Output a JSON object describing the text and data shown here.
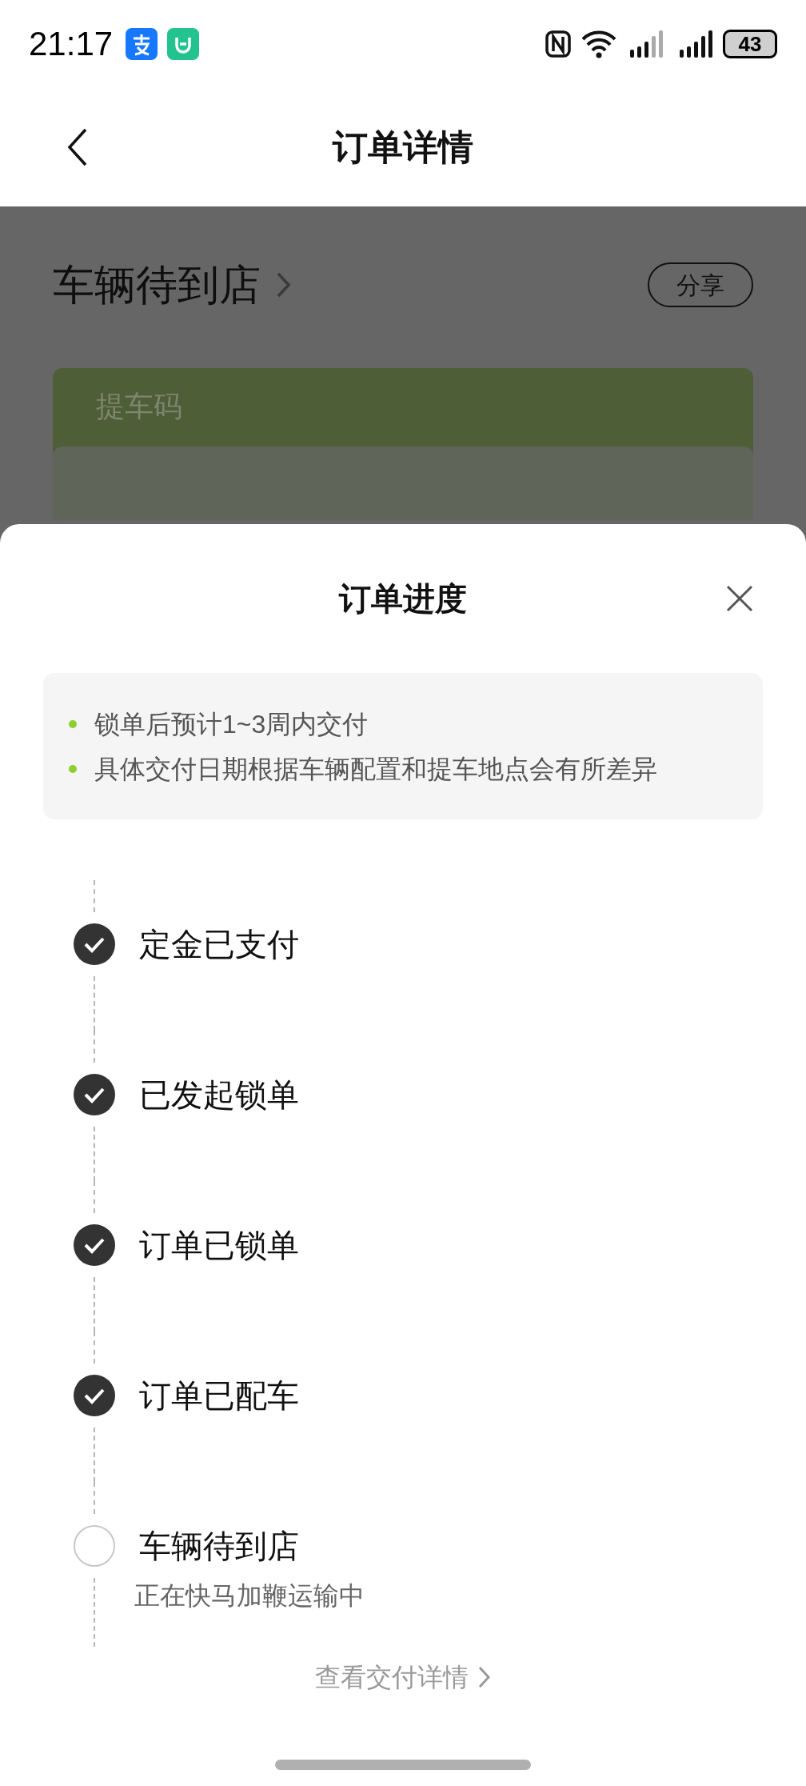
{
  "status_bar": {
    "time": "21:17",
    "battery": "43"
  },
  "header": {
    "title": "订单详情"
  },
  "page": {
    "status_title": "车辆待到店",
    "share_button": "分享",
    "card_label": "提车码"
  },
  "sheet": {
    "title": "订单进度",
    "notes": [
      "锁单后预计1~3周内交付",
      "具体交付日期根据车辆配置和提车地点会有所差异"
    ],
    "steps": [
      {
        "label": "定金已支付",
        "done": true
      },
      {
        "label": "已发起锁单",
        "done": true
      },
      {
        "label": "订单已锁单",
        "done": true
      },
      {
        "label": "订单已配车",
        "done": true
      },
      {
        "label": "车辆待到店",
        "done": false,
        "detail": "正在快马加鞭运输中"
      }
    ],
    "link": "查看交付详情"
  }
}
